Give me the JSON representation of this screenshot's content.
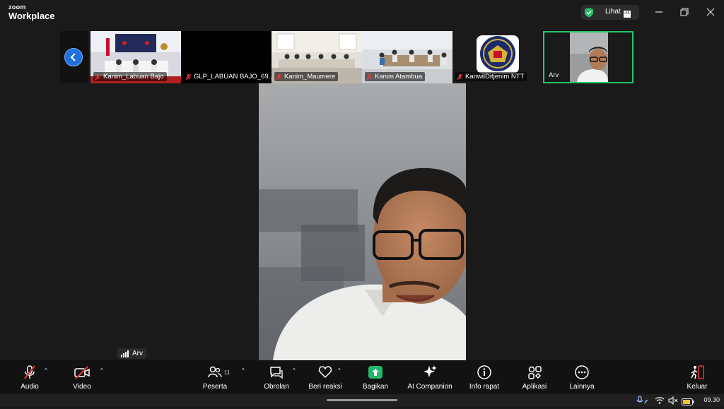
{
  "app": {
    "brand_top": "zoom",
    "brand_bottom": "Workplace"
  },
  "titlebar": {
    "view_label": "Lihat",
    "icons": [
      "shield-check-icon",
      "grid-icon",
      "minimize-icon",
      "restore-icon",
      "close-icon"
    ]
  },
  "gallery": {
    "participants": [
      {
        "name": "Kanim_Labuan Bajo",
        "muted": true
      },
      {
        "name": "GLP_LABUAN BAJO_69...",
        "muted": true
      },
      {
        "name": "Kanim_Maumere",
        "muted": true
      },
      {
        "name": "Kanim Atambua",
        "muted": true
      },
      {
        "name": "KanwilDitjenim NTT",
        "muted": true
      },
      {
        "name": "Arv",
        "muted": false,
        "active_speaker": true
      }
    ]
  },
  "main": {
    "speaker_name": "Arv"
  },
  "toolbar": {
    "audio": "Audio",
    "video": "Video",
    "participants": "Peserta",
    "participants_count": "11",
    "chat": "Obrolan",
    "reactions": "Beri reaksi",
    "share": "Bagikan",
    "companion": "AI Companion",
    "meeting_info": "Info rapat",
    "apps": "Aplikasi",
    "more": "Lainnya",
    "leave": "Keluar"
  },
  "colors": {
    "share_green": "#1fb967",
    "leave_red": "#e5373b",
    "accent_blue": "#1e6fe0",
    "active_border": "#27c46b"
  },
  "taskbar": {
    "time": "09.30"
  }
}
